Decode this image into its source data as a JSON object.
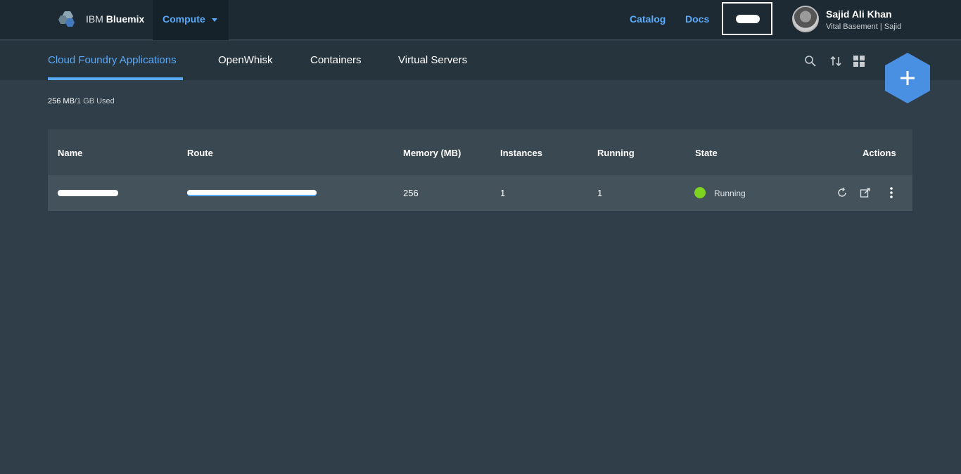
{
  "header": {
    "brand_prefix": "IBM",
    "brand_name": "Bluemix",
    "compute_label": "Compute",
    "catalog_label": "Catalog",
    "docs_label": "Docs",
    "user_name": "Sajid Ali Khan",
    "user_org": "Vital Basement | Sajid"
  },
  "tabs": [
    {
      "label": "Cloud Foundry Applications",
      "active": true
    },
    {
      "label": "OpenWhisk",
      "active": false
    },
    {
      "label": "Containers",
      "active": false
    },
    {
      "label": "Virtual Servers",
      "active": false
    }
  ],
  "usage": {
    "used": "256 MB",
    "total": "/1 GB Used"
  },
  "table": {
    "columns": [
      "Name",
      "Route",
      "Memory (MB)",
      "Instances",
      "Running",
      "State",
      "Actions"
    ],
    "rows": [
      {
        "memory": "256",
        "instances": "1",
        "running": "1",
        "state": "Running"
      }
    ]
  },
  "colors": {
    "accent": "#5aaafa",
    "running": "#7ed321",
    "background": "#2f3e48",
    "topbar": "#1d2a33",
    "fab": "#4a90e2"
  },
  "icons": {
    "logo": "bluemix-logo-icon",
    "search": "search-icon",
    "sort": "sort-icon",
    "grid": "grid-view-icon",
    "add": "plus-icon",
    "restart": "restart-icon",
    "open": "open-external-icon",
    "more": "more-vertical-icon"
  }
}
